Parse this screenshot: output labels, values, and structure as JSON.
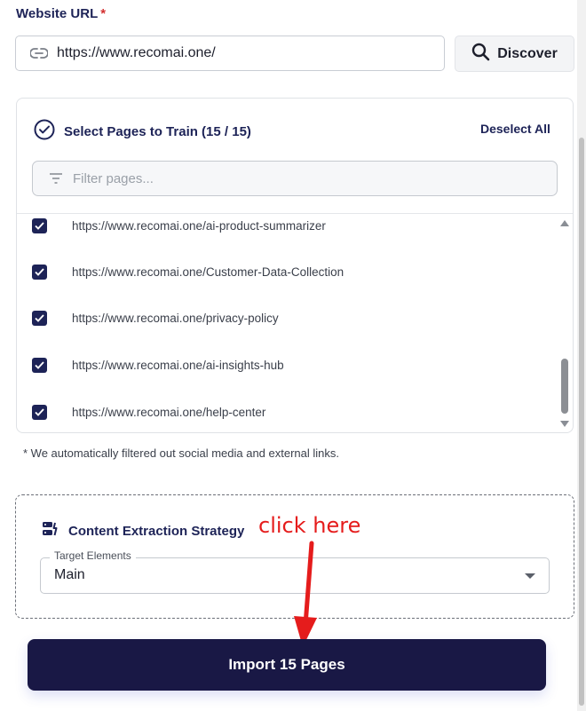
{
  "form": {
    "url_label": "Website URL",
    "required_mark": "*",
    "url_value": "https://www.recomai.one/",
    "discover_label": "Discover"
  },
  "pages": {
    "title": "Select Pages to Train (15 / 15)",
    "deselect_label": "Deselect All",
    "filter_placeholder": "Filter pages...",
    "items": [
      {
        "url": "https://www.recomai.one/ai-product-summarizer",
        "checked": true
      },
      {
        "url": "https://www.recomai.one/Customer-Data-Collection",
        "checked": true
      },
      {
        "url": "https://www.recomai.one/privacy-policy",
        "checked": true
      },
      {
        "url": "https://www.recomai.one/ai-insights-hub",
        "checked": true
      },
      {
        "url": "https://www.recomai.one/help-center",
        "checked": true
      }
    ],
    "note": "* We automatically filtered out social media and external links."
  },
  "strategy": {
    "title": "Content Extraction Strategy",
    "select_label": "Target Elements",
    "select_value": "Main"
  },
  "annotation": {
    "text": "click here",
    "color": "#e51c1c"
  },
  "import_button": {
    "label": "Import 15 Pages"
  },
  "colors": {
    "primary": "#1d2357",
    "button_dark": "#191845",
    "required": "#d32f2f"
  }
}
